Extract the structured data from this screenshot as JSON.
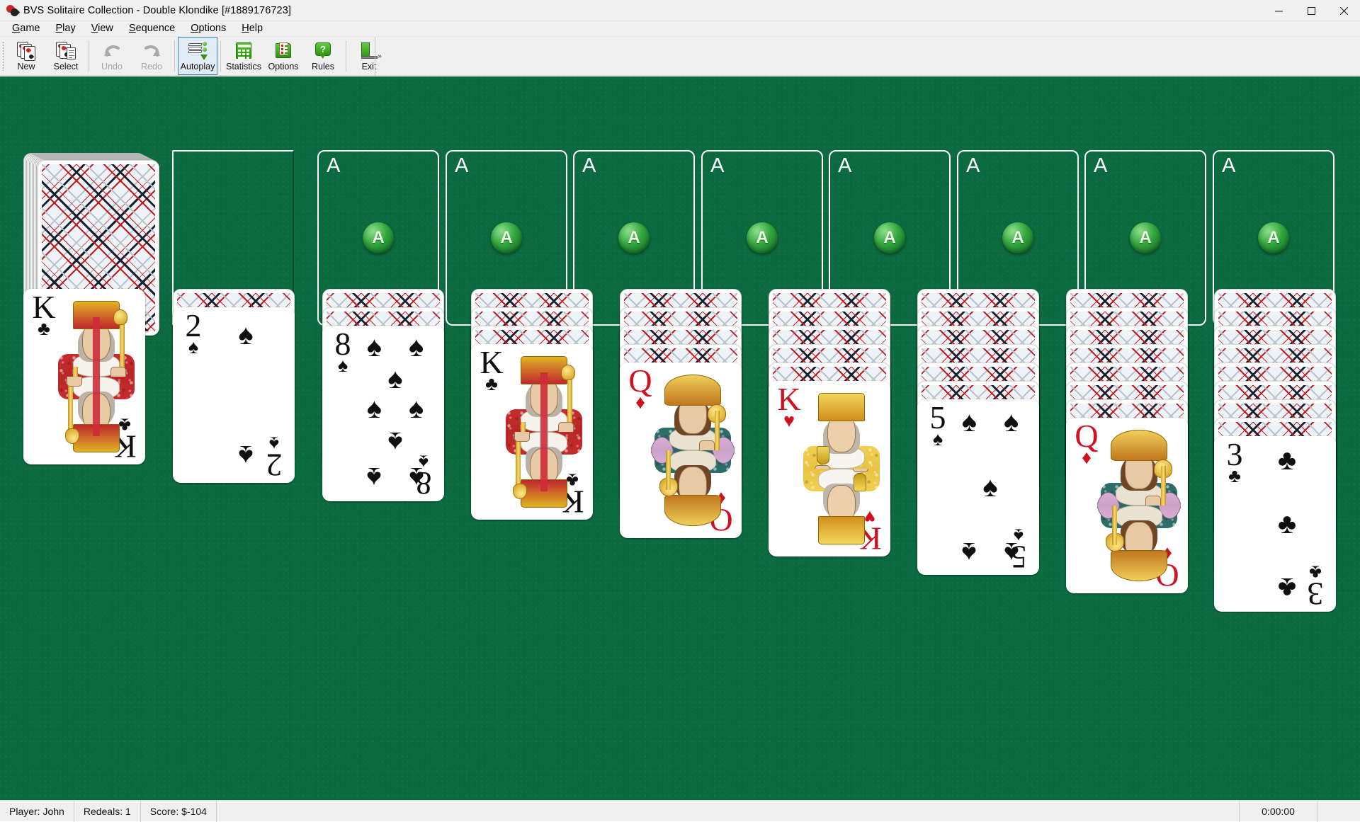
{
  "window": {
    "title": "BVS Solitaire Collection  -  Double Klondike [#1889176723]",
    "icon": "cards-app-icon",
    "minimize_label": "—",
    "maximize_label": "❐",
    "close_label": "✕"
  },
  "menu": {
    "items": [
      {
        "label": "Game",
        "accel": "G"
      },
      {
        "label": "Play",
        "accel": "P"
      },
      {
        "label": "View",
        "accel": "V"
      },
      {
        "label": "Sequence",
        "accel": "S"
      },
      {
        "label": "Options",
        "accel": "O"
      },
      {
        "label": "Help",
        "accel": "H"
      }
    ]
  },
  "toolbar": {
    "buttons": [
      {
        "label": "New",
        "icon": "new-game-icon",
        "state": "enabled"
      },
      {
        "label": "Select",
        "icon": "select-game-icon",
        "state": "enabled"
      },
      {
        "label": "Undo",
        "icon": "undo-arrow-icon",
        "state": "disabled"
      },
      {
        "label": "Redo",
        "icon": "redo-arrow-icon",
        "state": "disabled"
      },
      {
        "label": "Autoplay",
        "icon": "autoplay-icon",
        "state": "active"
      },
      {
        "label": "Statistics",
        "icon": "statistics-icon",
        "state": "enabled"
      },
      {
        "label": "Options",
        "icon": "options-icon",
        "state": "enabled"
      },
      {
        "label": "Rules",
        "icon": "rules-help-icon",
        "state": "enabled"
      },
      {
        "label": "Exit",
        "icon": "exit-door-icon",
        "state": "enabled"
      }
    ],
    "overflow_label": "»"
  },
  "game": {
    "felt_color": "#0b6b3f",
    "stock": {
      "name": "stock-pile",
      "cards_remaining_visual": 12,
      "face": "back"
    },
    "waste": {
      "name": "waste-pile",
      "empty": true
    },
    "foundations": [
      {
        "corner_label": "A",
        "orb_label": "A"
      },
      {
        "corner_label": "A",
        "orb_label": "A"
      },
      {
        "corner_label": "A",
        "orb_label": "A"
      },
      {
        "corner_label": "A",
        "orb_label": "A"
      },
      {
        "corner_label": "A",
        "orb_label": "A"
      },
      {
        "corner_label": "A",
        "orb_label": "A"
      },
      {
        "corner_label": "A",
        "orb_label": "A"
      },
      {
        "corner_label": "A",
        "orb_label": "A"
      }
    ],
    "tableau": [
      {
        "column": 1,
        "facedown": 0,
        "faceup": {
          "rank": "K",
          "suit": "clubs",
          "suit_glyph": "♣",
          "color": "black",
          "type": "court"
        }
      },
      {
        "column": 2,
        "facedown": 1,
        "faceup": {
          "rank": "2",
          "suit": "spades",
          "suit_glyph": "♠",
          "color": "black",
          "type": "pip"
        }
      },
      {
        "column": 3,
        "facedown": 2,
        "faceup": {
          "rank": "8",
          "suit": "spades",
          "suit_glyph": "♠",
          "color": "black",
          "type": "pip"
        }
      },
      {
        "column": 4,
        "facedown": 3,
        "faceup": {
          "rank": "K",
          "suit": "clubs",
          "suit_glyph": "♣",
          "color": "black",
          "type": "court"
        }
      },
      {
        "column": 5,
        "facedown": 4,
        "faceup": {
          "rank": "Q",
          "suit": "diamonds",
          "suit_glyph": "♦",
          "color": "red",
          "type": "court"
        }
      },
      {
        "column": 6,
        "facedown": 5,
        "faceup": {
          "rank": "K",
          "suit": "hearts",
          "suit_glyph": "♥",
          "color": "red",
          "type": "court"
        }
      },
      {
        "column": 7,
        "facedown": 6,
        "faceup": {
          "rank": "5",
          "suit": "spades",
          "suit_glyph": "♠",
          "color": "black",
          "type": "pip"
        }
      },
      {
        "column": 8,
        "facedown": 7,
        "faceup": {
          "rank": "Q",
          "suit": "diamonds",
          "suit_glyph": "♦",
          "color": "red",
          "type": "court"
        }
      },
      {
        "column": 9,
        "facedown": 8,
        "faceup": {
          "rank": "3",
          "suit": "clubs",
          "suit_glyph": "♣",
          "color": "black",
          "type": "pip"
        }
      }
    ]
  },
  "statusbar": {
    "player": "Player: John",
    "redeals": "Redeals: 1",
    "score": "Score: $-104",
    "timer": "0:00:00"
  }
}
